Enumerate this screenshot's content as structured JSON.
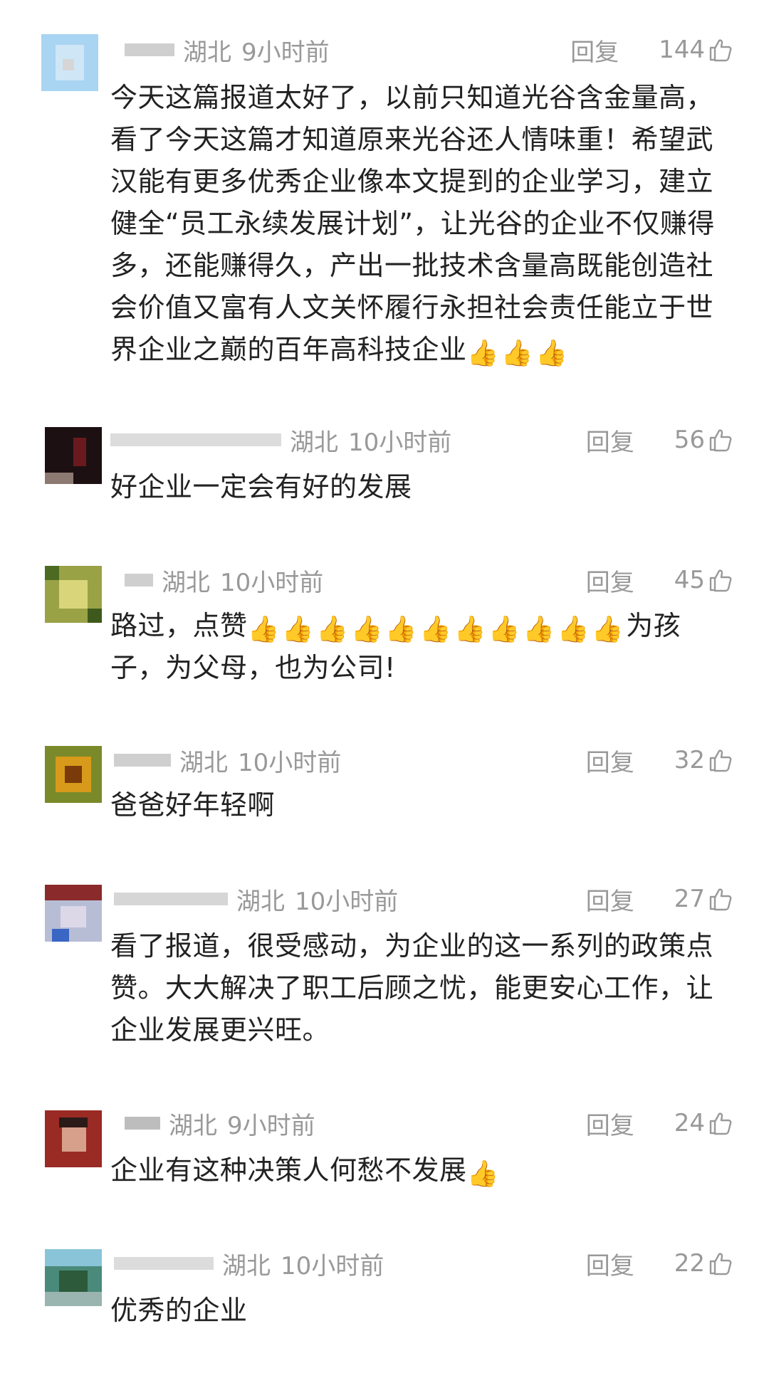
{
  "ui": {
    "reply_label": "回复",
    "thumb_emoji": "👍",
    "like_icon": "thumb-up-outline-icon"
  },
  "comments": [
    {
      "location": "湖北",
      "time": "9小时前",
      "likes": "144",
      "text_parts": [
        "今天这篇报道太好了，以前只知道光谷含金量高，看了今天这篇才知道原来光谷还人情味重！希望武汉能有更多优秀企业像本文提到的企业学习，建立健全“员工永续发展计划”，让光谷的企业不仅赚得多，还能赚得久，产出一批技术含量高既能创造社会价值又富有人文关怀履行永担社会责任能立于世界企业之巅的百年高科技企业"
      ],
      "thumbs": 3
    },
    {
      "location": "湖北",
      "time": "10小时前",
      "likes": "56",
      "text_parts": [
        "好企业一定会有好的发展"
      ],
      "thumbs": 0
    },
    {
      "location": "湖北",
      "time": "10小时前",
      "likes": "45",
      "text_parts": [
        "路过，点赞",
        "为孩子，为父母，也为公司!"
      ],
      "thumbs": 11
    },
    {
      "location": "湖北",
      "time": "10小时前",
      "likes": "32",
      "text_parts": [
        "爸爸好年轻啊"
      ],
      "thumbs": 0
    },
    {
      "location": "湖北",
      "time": "10小时前",
      "likes": "27",
      "text_parts": [
        "看了报道，很受感动，为企业的这一系列的政策点赞。大大解决了职工后顾之忧，能更安心工作，让企业发展更兴旺。"
      ],
      "thumbs": 0
    },
    {
      "location": "湖北",
      "time": "9小时前",
      "likes": "24",
      "text_parts": [
        "企业有这种决策人何愁不发展"
      ],
      "thumbs": 1
    },
    {
      "location": "湖北",
      "time": "10小时前",
      "likes": "22",
      "text_parts": [
        "优秀的企业"
      ],
      "thumbs": 0
    }
  ]
}
